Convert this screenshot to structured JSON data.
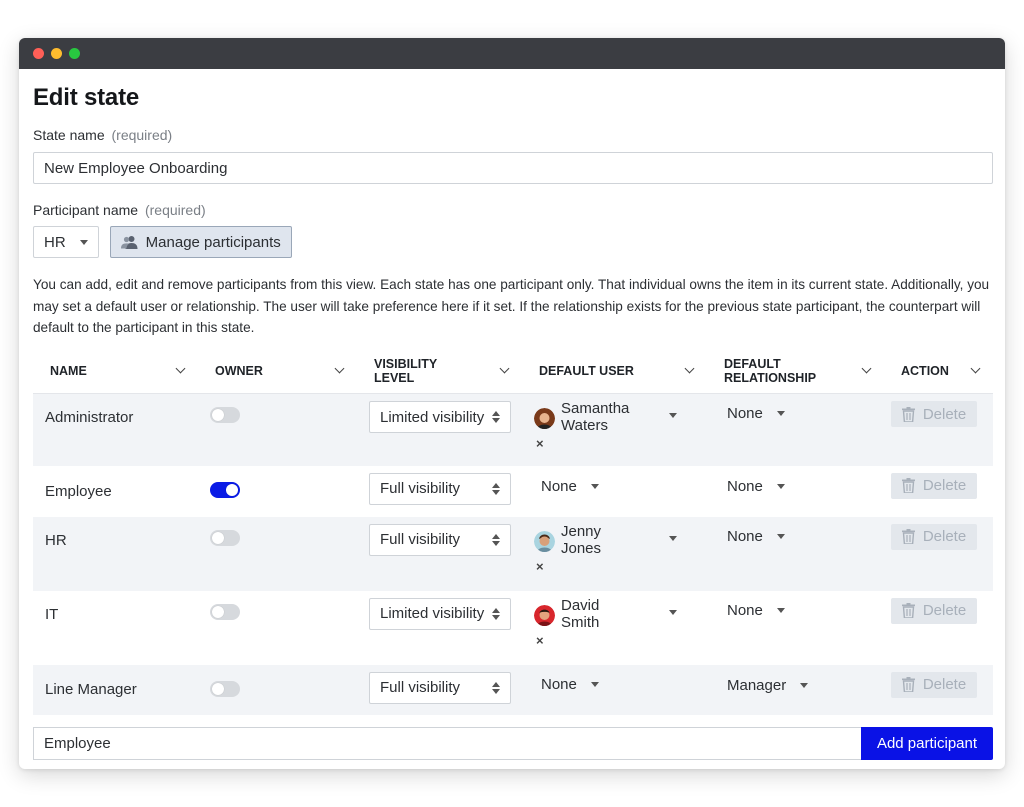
{
  "page": {
    "title": "Edit state"
  },
  "state_name": {
    "label": "State name",
    "required_text": "(required)",
    "value": "New Employee Onboarding"
  },
  "participant_name": {
    "label": "Participant name",
    "required_text": "(required)",
    "selected": "HR",
    "manage_label": "Manage participants"
  },
  "help_text": "You can add, edit and remove participants from this view. Each state has one participant only. That individual owns the item in its current state. Additionally, you may set a default user or relationship. The user will take preference here if it set. If the relationship exists for the previous state participant, the counterpart will default to the participant in this state.",
  "table": {
    "headers": [
      {
        "line1": "NAME",
        "line2": ""
      },
      {
        "line1": "OWNER",
        "line2": ""
      },
      {
        "line1": "VISIBILITY",
        "line2": "LEVEL"
      },
      {
        "line1": "DEFAULT USER",
        "line2": ""
      },
      {
        "line1": "DEFAULT",
        "line2": "RELATIONSHIP"
      },
      {
        "line1": "ACTION",
        "line2": ""
      }
    ],
    "rows": [
      {
        "name": "Administrator",
        "owner": false,
        "visibility": "Limited visibility",
        "user_first": "Samantha",
        "user_last": "Waters",
        "user_none": "",
        "relationship": "None",
        "action": "Delete"
      },
      {
        "name": "Employee",
        "owner": true,
        "visibility": "Full visibility",
        "user_first": "",
        "user_last": "",
        "user_none": "None",
        "relationship": "None",
        "action": "Delete"
      },
      {
        "name": "HR",
        "owner": false,
        "visibility": "Full visibility",
        "user_first": "Jenny",
        "user_last": "Jones",
        "user_none": "",
        "relationship": "None",
        "action": "Delete"
      },
      {
        "name": "IT",
        "owner": false,
        "visibility": "Limited visibility",
        "user_first": "David",
        "user_last": "Smith",
        "user_none": "",
        "relationship": "None",
        "action": "Delete"
      },
      {
        "name": "Line Manager",
        "owner": false,
        "visibility": "Full visibility",
        "user_first": "",
        "user_last": "",
        "user_none": "None",
        "relationship": "Manager",
        "action": "Delete"
      }
    ]
  },
  "add": {
    "input_value": "Employee",
    "button_label": "Add participant"
  },
  "remove_glyph": "×",
  "colors": {
    "primary": "#0a12e6",
    "toggle_on": "#0a1be6",
    "row_shade": "#f2f4f7",
    "titlebar": "#3b3d42"
  },
  "icons": {
    "manage": "users-icon",
    "delete": "trash-icon"
  }
}
